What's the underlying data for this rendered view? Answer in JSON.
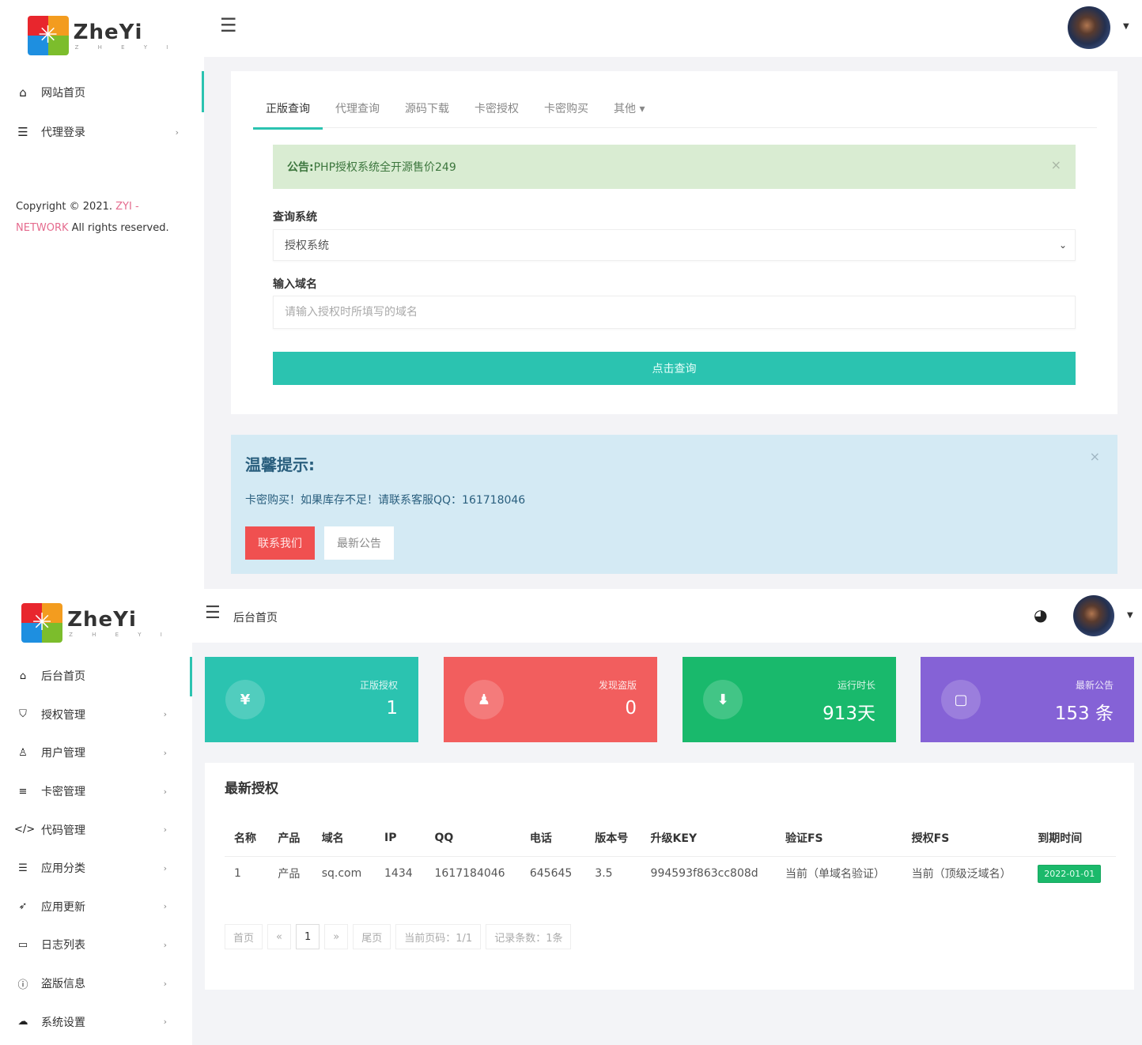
{
  "brand": {
    "name": "ZheYi",
    "subtitle": "Z H E Y I"
  },
  "top": {
    "sidebar": {
      "items": [
        {
          "label": "网站首页",
          "icon": "home-icon",
          "active": true
        },
        {
          "label": "代理登录",
          "icon": "list-icon",
          "has_submenu": true
        }
      ],
      "copyright": {
        "prefix": "Copyright © 2021. ",
        "link1": "ZYI -",
        "link2": "NETWORK",
        "suffix": " All rights reserved."
      }
    },
    "tabs": [
      {
        "label": "正版查询",
        "active": true
      },
      {
        "label": "代理查询"
      },
      {
        "label": "源码下载"
      },
      {
        "label": "卡密授权"
      },
      {
        "label": "卡密购买"
      },
      {
        "label": "其他 ▾"
      }
    ],
    "notice": {
      "label": "公告:",
      "text": " PHP授权系统全开源售价249",
      "close": "×"
    },
    "form": {
      "system_label": "查询系统",
      "system_value": "授权系统",
      "domain_label": "输入域名",
      "domain_value": "",
      "domain_placeholder": "请输入授权时所填写的域名",
      "submit": "点击查询"
    },
    "tip": {
      "title": "温馨提示:",
      "message": "卡密购买！如果库存不足！请联系客服QQ：161718046",
      "contact_btn": "联系我们",
      "news_btn": "最新公告",
      "close": "×"
    }
  },
  "bottom": {
    "header": {
      "breadcrumb": "后台首页"
    },
    "sidebar": {
      "items": [
        {
          "label": "后台首页",
          "icon": "⌂",
          "active": true
        },
        {
          "label": "授权管理",
          "icon": "⛉"
        },
        {
          "label": "用户管理",
          "icon": "♙"
        },
        {
          "label": "卡密管理",
          "icon": "≡"
        },
        {
          "label": "代码管理",
          "icon": "</>"
        },
        {
          "label": "应用分类",
          "icon": "☰"
        },
        {
          "label": "应用更新",
          "icon": "➶"
        },
        {
          "label": "日志列表",
          "icon": "▭"
        },
        {
          "label": "盗版信息",
          "icon": "ⓘ"
        },
        {
          "label": "系统设置",
          "icon": "☁"
        }
      ]
    },
    "stats": [
      {
        "label": "正版授权",
        "value": "1",
        "icon": "¥",
        "color": "#2bc3b0"
      },
      {
        "label": "发现盗版",
        "value": "0",
        "icon": "♟",
        "color": "#f25e5e"
      },
      {
        "label": "运行时长",
        "value": "913天",
        "icon": "⬇",
        "color": "#19b96c"
      },
      {
        "label": "最新公告",
        "value": "153 条",
        "icon": "▢",
        "color": "#8562d6"
      }
    ],
    "latest": {
      "title": "最新授权",
      "columns": [
        "名称",
        "产品",
        "域名",
        "IP",
        "QQ",
        "电话",
        "版本号",
        "升级KEY",
        "验证FS",
        "授权FS",
        "到期时间"
      ],
      "rows": [
        [
          "1",
          "产品",
          "sq.com",
          "1434",
          "1617184046",
          "645645",
          "3.5",
          "994593f863cc808d",
          "当前（单域名验证）",
          "当前（顶级泛域名）",
          "2022-01-01"
        ]
      ]
    },
    "pagination": {
      "first": "首页",
      "prev": "«",
      "current": "1",
      "next": "»",
      "last": "尾页",
      "page_info": "当前页码：1/1",
      "record_info": "记录条数：1条"
    }
  }
}
